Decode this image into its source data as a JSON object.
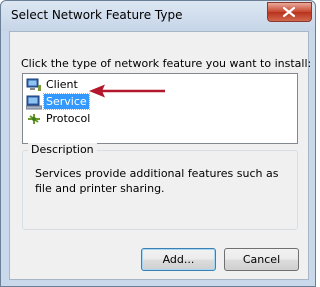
{
  "window": {
    "title": "Select Network Feature Type"
  },
  "instruction": "Click the type of network feature you want to install:",
  "features": [
    {
      "label": "Client",
      "icon": "client-icon",
      "selected": false
    },
    {
      "label": "Service",
      "icon": "service-icon",
      "selected": true
    },
    {
      "label": "Protocol",
      "icon": "protocol-icon",
      "selected": false
    }
  ],
  "description": {
    "group_label": "Description",
    "text": "Services provide additional features such as file and printer sharing."
  },
  "buttons": {
    "add": "Add...",
    "cancel": "Cancel"
  },
  "colors": {
    "selection": "#3399ff",
    "arrow": "#b2172b"
  }
}
